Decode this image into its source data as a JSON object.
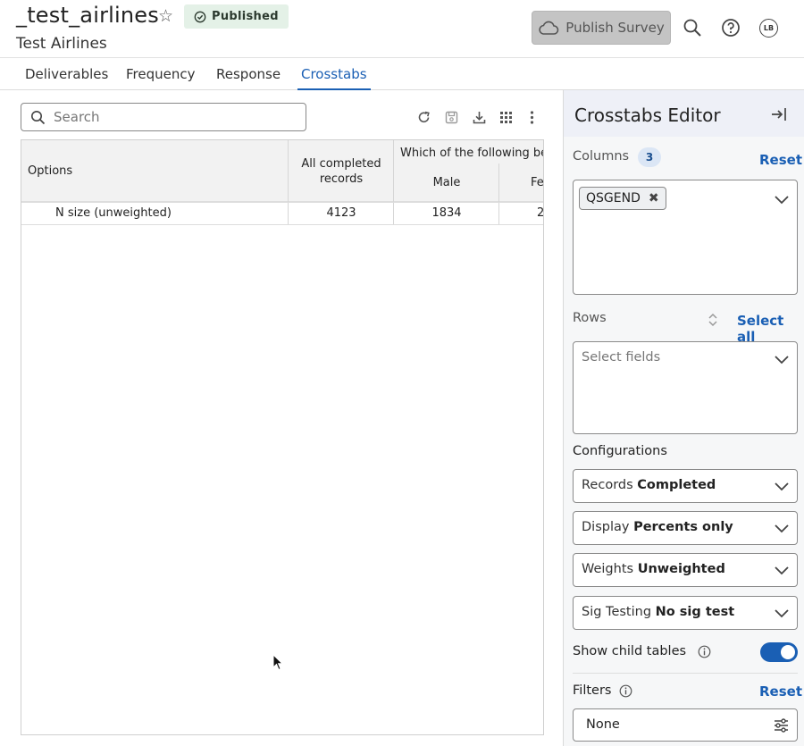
{
  "header": {
    "title": "_test_airlines",
    "status_badge": "Published",
    "subtitle": "Test Airlines",
    "publish_button": "Publish Survey",
    "avatar_initials": "LB"
  },
  "tabs": [
    {
      "label": "Deliverables",
      "active": false
    },
    {
      "label": "Frequency",
      "active": false
    },
    {
      "label": "Response",
      "active": false
    },
    {
      "label": "Crosstabs",
      "active": true
    }
  ],
  "search": {
    "placeholder": "Search"
  },
  "table": {
    "header_options": "Options",
    "header_all": "All completed records",
    "header_group": "Which of the following bes",
    "header_male": "Male",
    "header_female": "Fe",
    "rows": [
      {
        "label": "N size (unweighted)",
        "all": "4123",
        "male": "1834",
        "female": "2"
      }
    ]
  },
  "panel": {
    "title": "Crosstabs Editor",
    "columns_label": "Columns",
    "columns_count": "3",
    "columns_reset": "Reset",
    "columns_chip": "QSGEND",
    "rows_label": "Rows",
    "rows_select_all": "Select all",
    "rows_placeholder": "Select fields",
    "configurations_label": "Configurations",
    "records": {
      "label": "Records",
      "value": "Completed"
    },
    "display": {
      "label": "Display",
      "value": "Percents only"
    },
    "weights": {
      "label": "Weights",
      "value": "Unweighted"
    },
    "sig_testing": {
      "label": "Sig Testing",
      "value": "No sig test"
    },
    "show_child_tables": "Show child tables",
    "show_child_tables_on": true,
    "filters_label": "Filters",
    "filters_reset": "Reset",
    "filters_value": "None"
  },
  "colors": {
    "accent": "#1a5fb4",
    "badge_bg": "#e4f1e7",
    "publish_disabled": "#c4c4c4"
  }
}
